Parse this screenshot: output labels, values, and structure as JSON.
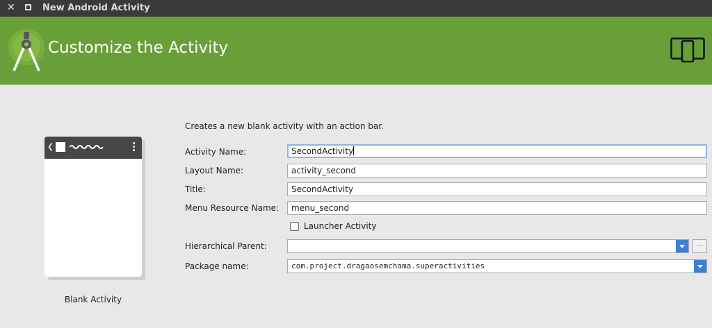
{
  "window": {
    "title": "New Android Activity",
    "close_glyph": "✕"
  },
  "header": {
    "title": "Customize the Activity",
    "logo_icon": "android-studio-logo-icon",
    "device_icon": "device-tablet-phone-icon",
    "background_color": "#689f38"
  },
  "preview": {
    "label": "Blank Activity",
    "back_glyph": "❮"
  },
  "form": {
    "description": "Creates a new blank activity with an action bar.",
    "activity_name": {
      "label": "Activity Name:",
      "value": "SecondActivity"
    },
    "layout_name": {
      "label": "Layout Name:",
      "value": "activity_second"
    },
    "title": {
      "label": "Title:",
      "value": "SecondActivity"
    },
    "menu_resource_name": {
      "label": "Menu Resource Name:",
      "value": "menu_second"
    },
    "launcher_activity": {
      "label": "Launcher Activity",
      "checked": false
    },
    "hierarchical_parent": {
      "label": "Hierarchical Parent:",
      "value": "",
      "browse_label": "..."
    },
    "package_name": {
      "label": "Package name:",
      "value": "com.project.dragaosemchama.superactivities"
    }
  }
}
